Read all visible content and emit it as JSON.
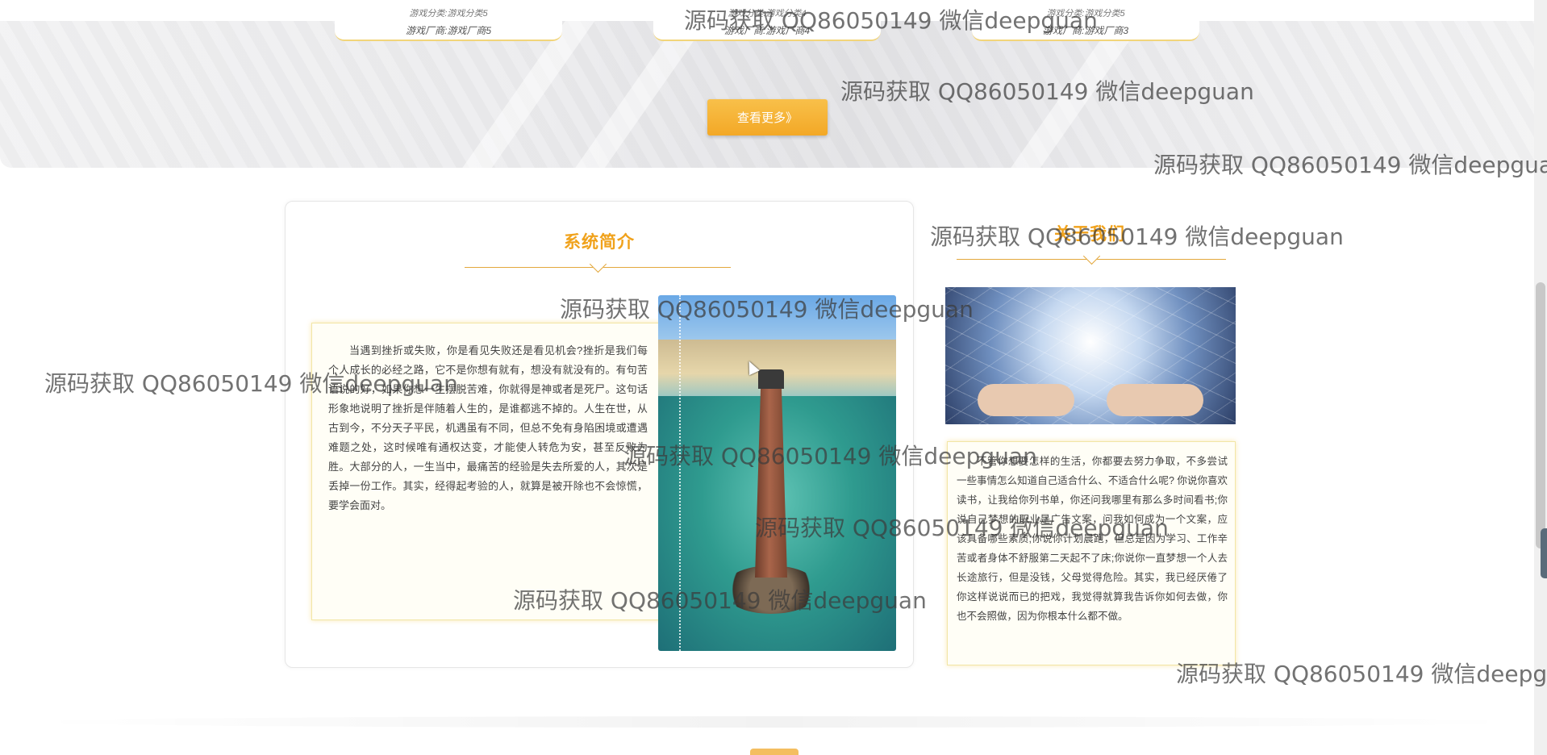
{
  "game_cards": [
    {
      "line_top": "游戏分类:游戏分类5",
      "vendor": "游戏厂商:游戏厂商5"
    },
    {
      "line_top": "游戏分类:游戏分类4",
      "vendor": "游戏厂商:游戏厂商4"
    },
    {
      "line_top": "游戏分类:游戏分类5",
      "vendor": "游戏厂商:游戏厂商3"
    }
  ],
  "more_button": "查看更多》",
  "system_intro": {
    "title": "系统简介",
    "text": "当遇到挫折或失败，你是看见失败还是看见机会?挫折是我们每个人成长的必经之路，它不是你想有就有，想没有就没有的。有句苦语说的好，如果你想一生摆脱苦难，你就得是神或者是死尸。这句话形象地说明了挫折是伴随着人生的，是谁都逃不掉的。人生在世，从古到今，不分天子平民，机遇虽有不同，但总不免有身陷困境或遭遇难题之处，这时候唯有通权达变，才能使人转危为安，甚至反败为胜。大部分的人，一生当中，最痛苦的经验是失去所爱的人，其次是丢掉一份工作。其实，经得起考验的人，就算是被开除也不会惊慌，要学会面对。"
  },
  "about_us": {
    "title": "关于我们",
    "text": "不管你想要怎样的生活，你都要去努力争取，不多尝试一些事情怎么知道自己适合什么、不适合什么呢? 你说你喜欢读书，让我给你列书单，你还问我哪里有那么多时间看书;你说自己梦想的职业是广告文案，问我如何成为一个文案，应该具备哪些素质;你说你计划晨跑，但总是因为学习、工作辛苦或者身体不舒服第二天起不了床;你说你一直梦想一个人去长途旅行，但是没钱，父母觉得危险。其实，我已经厌倦了你这样说说而已的把戏，我觉得就算我告诉你如何去做，你也不会照做，因为你根本什么都不做。"
  },
  "watermark_text": "源码获取 QQ86050149 微信deepguan"
}
